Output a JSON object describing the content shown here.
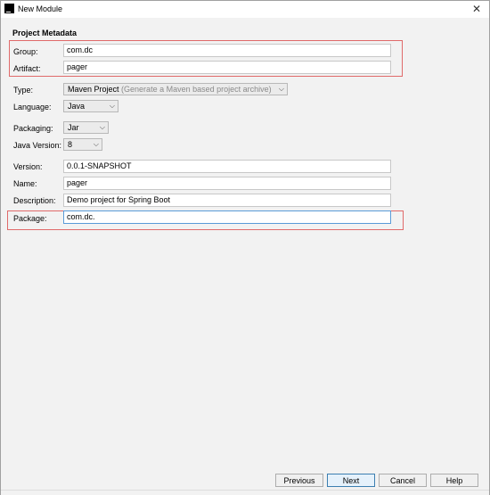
{
  "window": {
    "title": "New Module",
    "app_icon_text": "IJ"
  },
  "section_heading": "Project Metadata",
  "fields": {
    "group": {
      "label": "Group:",
      "value": "com.dc"
    },
    "artifact": {
      "label": "Artifact:",
      "value": "pager"
    },
    "version": {
      "label": "Version:",
      "value": "0.0.1-SNAPSHOT"
    },
    "name": {
      "label": "Name:",
      "value": "pager"
    },
    "description": {
      "label": "Description:",
      "value": "Demo project for Spring Boot"
    },
    "package": {
      "label": "Package:",
      "value": "com.dc."
    }
  },
  "combos": {
    "type": {
      "label": "Type:",
      "value": "Maven Project",
      "hint": "(Generate a Maven based project archive)"
    },
    "language": {
      "label": "Language:",
      "value": "Java"
    },
    "packaging": {
      "label": "Packaging:",
      "value": "Jar"
    },
    "java_version": {
      "label": "Java Version:",
      "value": "8"
    }
  },
  "buttons": {
    "previous": "Previous",
    "next": "Next",
    "cancel": "Cancel",
    "help": "Help"
  },
  "colors": {
    "highlight_box": "#e06a6a",
    "focus_border": "#5a9bd8",
    "dialog_bg": "#f2f2f2"
  }
}
